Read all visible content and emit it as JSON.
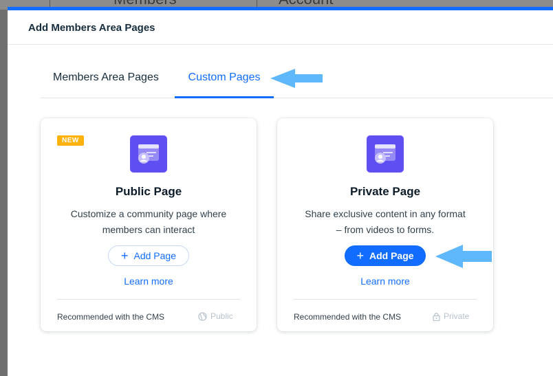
{
  "background": {
    "left_text": "Members",
    "right_text": "Account"
  },
  "modal": {
    "title": "Add Members Area Pages"
  },
  "tabs": [
    {
      "label": "Members Area Pages",
      "active": false
    },
    {
      "label": "Custom Pages",
      "active": true
    }
  ],
  "cards": [
    {
      "badge": "NEW",
      "title": "Public Page",
      "description_line1": "Customize a community page where",
      "description_line2": "members can interact",
      "button_label": "Add Page",
      "learn_more": "Learn more",
      "footer_text": "Recommended with the CMS",
      "status_label": "Public",
      "status_icon": "globe-icon"
    },
    {
      "title": "Private Page",
      "description_line1": "Share exclusive content in any format",
      "description_line2": "– from videos to forms.",
      "button_label": "Add Page",
      "learn_more": "Learn more",
      "footer_text": "Recommended with the CMS",
      "status_label": "Private",
      "status_icon": "lock-icon"
    }
  ],
  "colors": {
    "accent": "#116dff",
    "icon_tile": "#5f4ef2",
    "badge": "#fdb10c",
    "annotation_arrow": "#5fb8fb"
  }
}
